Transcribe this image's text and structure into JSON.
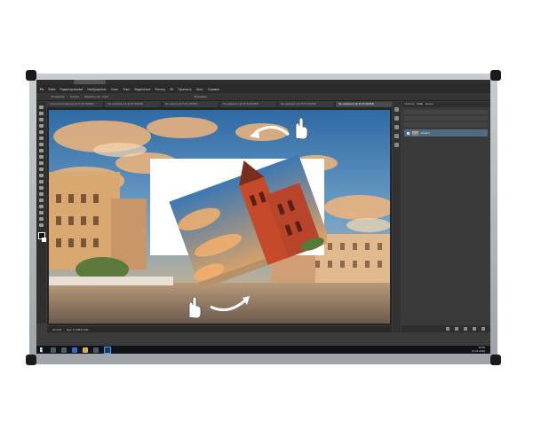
{
  "app": {
    "logo": "Ps",
    "menu": [
      "Файл",
      "Редактирование",
      "Изображение",
      "Слои",
      "Текст",
      "Выделение",
      "Фильтр",
      "3D",
      "Просмотр",
      "Окно",
      "Справка"
    ],
    "options": [
      "Автовыбор:",
      "Группа",
      "Показать упр. элем.",
      "3D-режим:"
    ],
    "document_tabs": [
      "Cloud-photo-Krakow.jpg @ 33,3% (RGB/8)",
      "Без названия-1 @ 33,3% (RGB/8)",
      "Без имени-2 @ 33,3% (RGB/8)",
      "Без названия-2 @ 33,3% (RGB/8)",
      "Без названия-3 @ 33,3% (RGB/8)",
      "Без названия-4 @ 33,3% (RGB/8)"
    ],
    "status": {
      "zoom": "33,33%",
      "doc": "Док: 8,79M/8,79M"
    },
    "panel": {
      "tabs": [
        "Свойства",
        "Слои",
        "Каналы"
      ],
      "layer_name": "Слой 1"
    },
    "taskbar": {
      "time": "10:56",
      "date": "27.01.2016"
    }
  },
  "colors": {
    "accent": "#31a8ff",
    "sky": "#3f7fb7",
    "cloud": "#f0b476",
    "building": "#c84a2c"
  },
  "icons": [
    "start-icon",
    "search-icon",
    "task-view-icon",
    "edge-icon",
    "explorer-icon",
    "store-icon",
    "photoshop-icon"
  ]
}
